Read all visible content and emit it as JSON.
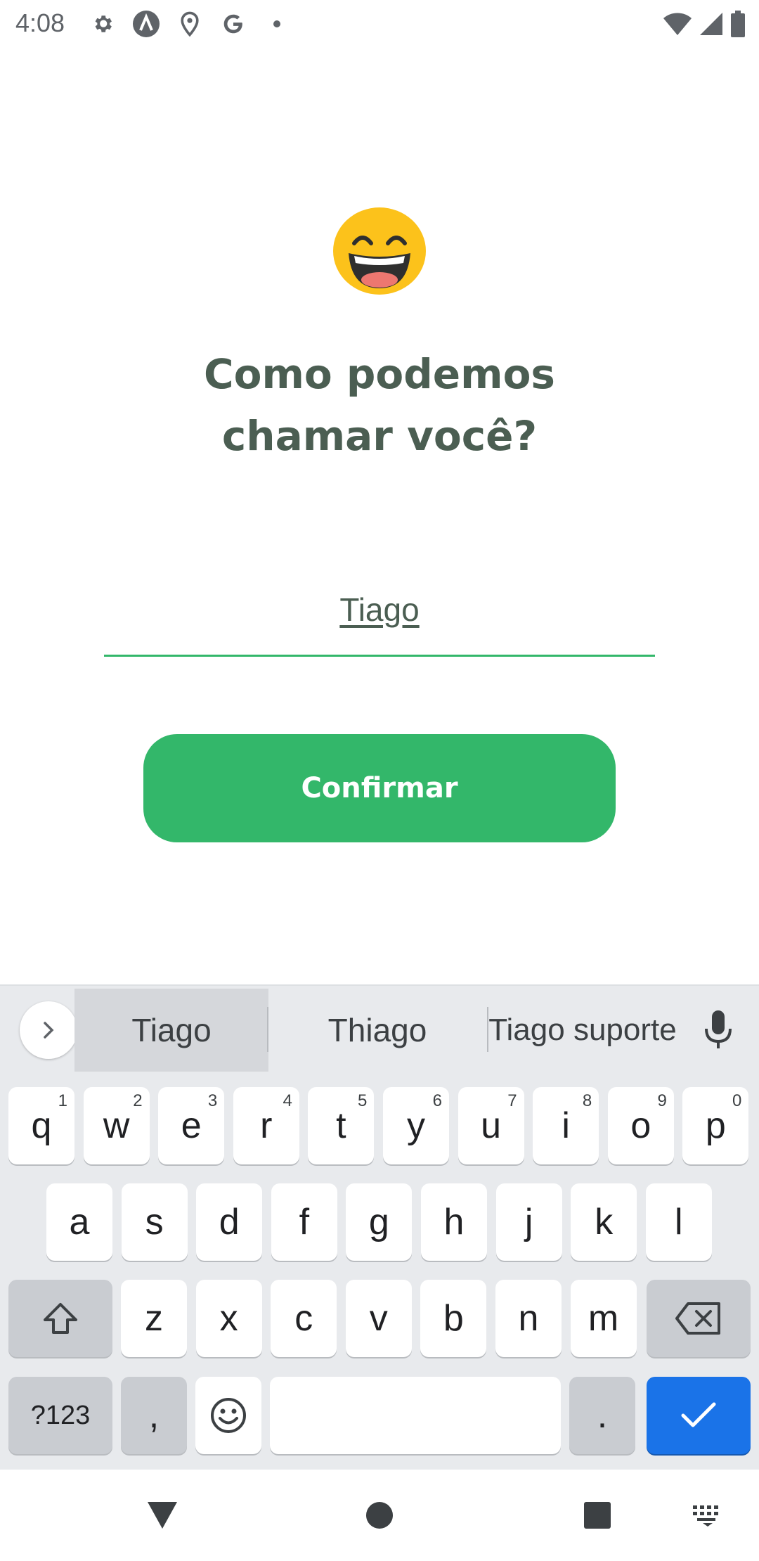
{
  "status_bar": {
    "time": "4:08",
    "left_icons": [
      "settings-icon",
      "app-logo-icon",
      "location-icon",
      "google-icon",
      "dot-icon"
    ],
    "right_icons": [
      "wifi-icon",
      "signal-icon",
      "battery-icon"
    ]
  },
  "main": {
    "emoji": "grinning-face-emoji",
    "title_line1": "Como podemos",
    "title_line2": "chamar você?",
    "name_value": "Tiago",
    "confirm_label": "Confirmar",
    "accent_color": "#33b76a",
    "text_color": "#4b5e52"
  },
  "keyboard": {
    "suggestions": [
      "Tiago",
      "Thiago",
      "Tiago suporte"
    ],
    "row1": [
      {
        "key": "q",
        "hint": "1"
      },
      {
        "key": "w",
        "hint": "2"
      },
      {
        "key": "e",
        "hint": "3"
      },
      {
        "key": "r",
        "hint": "4"
      },
      {
        "key": "t",
        "hint": "5"
      },
      {
        "key": "y",
        "hint": "6"
      },
      {
        "key": "u",
        "hint": "7"
      },
      {
        "key": "i",
        "hint": "8"
      },
      {
        "key": "o",
        "hint": "9"
      },
      {
        "key": "p",
        "hint": "0"
      }
    ],
    "row2": [
      "a",
      "s",
      "d",
      "f",
      "g",
      "h",
      "j",
      "k",
      "l"
    ],
    "row3": [
      "z",
      "x",
      "c",
      "v",
      "b",
      "n",
      "m"
    ],
    "symbols_label": "?123",
    "comma_label": ",",
    "period_label": ".",
    "enter_color": "#1a73e8"
  },
  "nav_bar": {
    "icons": [
      "back-icon",
      "home-icon",
      "recents-icon",
      "keyboard-switch-icon"
    ]
  }
}
